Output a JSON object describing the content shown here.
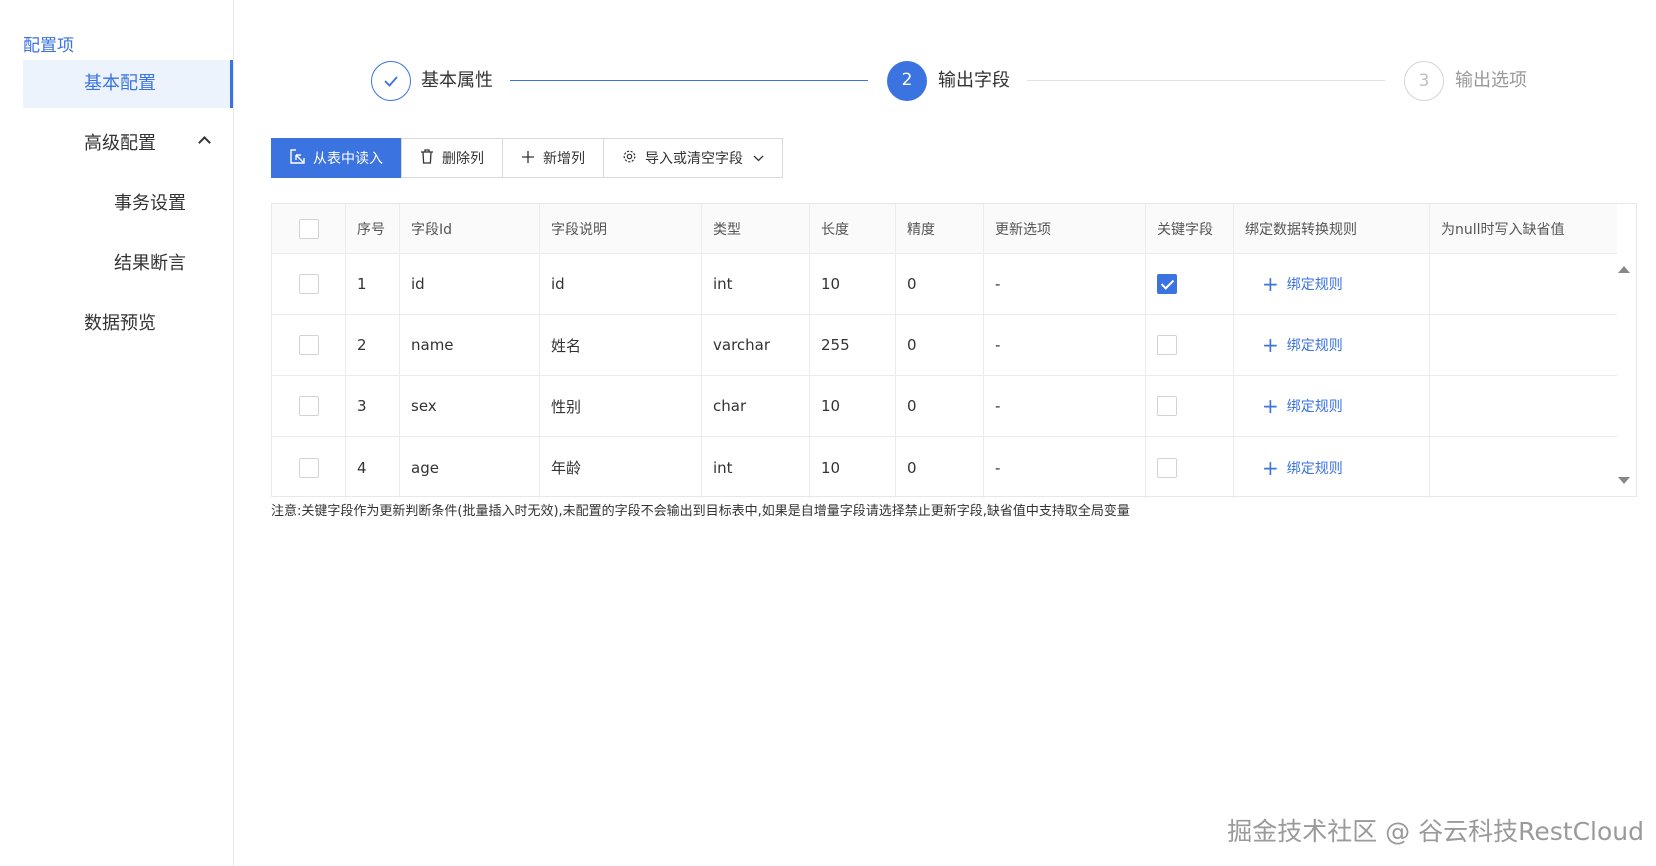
{
  "sidebar": {
    "title": "配置项",
    "items": [
      {
        "label": "基本配置"
      },
      {
        "label": "高级配置"
      },
      {
        "label": "事务设置"
      },
      {
        "label": "结果断言"
      },
      {
        "label": "数据预览"
      }
    ]
  },
  "steps": [
    {
      "label": "基本属性",
      "status": "done"
    },
    {
      "number": "2",
      "label": "输出字段",
      "status": "active"
    },
    {
      "number": "3",
      "label": "输出选项",
      "status": "wait"
    }
  ],
  "toolbar": {
    "read_from_table": "从表中读入",
    "delete_column": "删除列",
    "add_column": "新增列",
    "import_clear": "导入或清空字段"
  },
  "table": {
    "headers": [
      "序号",
      "字段Id",
      "字段说明",
      "类型",
      "长度",
      "精度",
      "更新选项",
      "关键字段",
      "绑定数据转换规则",
      "为null时写入缺省值"
    ],
    "bind_rule_label": "绑定规则",
    "rows": [
      {
        "index": "1",
        "field_id": "id",
        "description": "id",
        "type": "int",
        "length": "10",
        "precision": "0",
        "update_option": "-",
        "is_key": true
      },
      {
        "index": "2",
        "field_id": "name",
        "description": "姓名",
        "type": "varchar",
        "length": "255",
        "precision": "0",
        "update_option": "-",
        "is_key": false
      },
      {
        "index": "3",
        "field_id": "sex",
        "description": "性别",
        "type": "char",
        "length": "10",
        "precision": "0",
        "update_option": "-",
        "is_key": false
      },
      {
        "index": "4",
        "field_id": "age",
        "description": "年龄",
        "type": "int",
        "length": "10",
        "precision": "0",
        "update_option": "-",
        "is_key": false
      }
    ]
  },
  "note": "注意:关键字段作为更新判断条件(批量插入时无效),未配置的字段不会输出到目标表中,如果是自增量字段请选择禁止更新字段,缺省值中支持取全局变量",
  "watermark": "掘金技术社区 @ 谷云科技RestCloud",
  "colors": {
    "accent": "#3b73e0",
    "active_bg": "#ecf3fd"
  }
}
